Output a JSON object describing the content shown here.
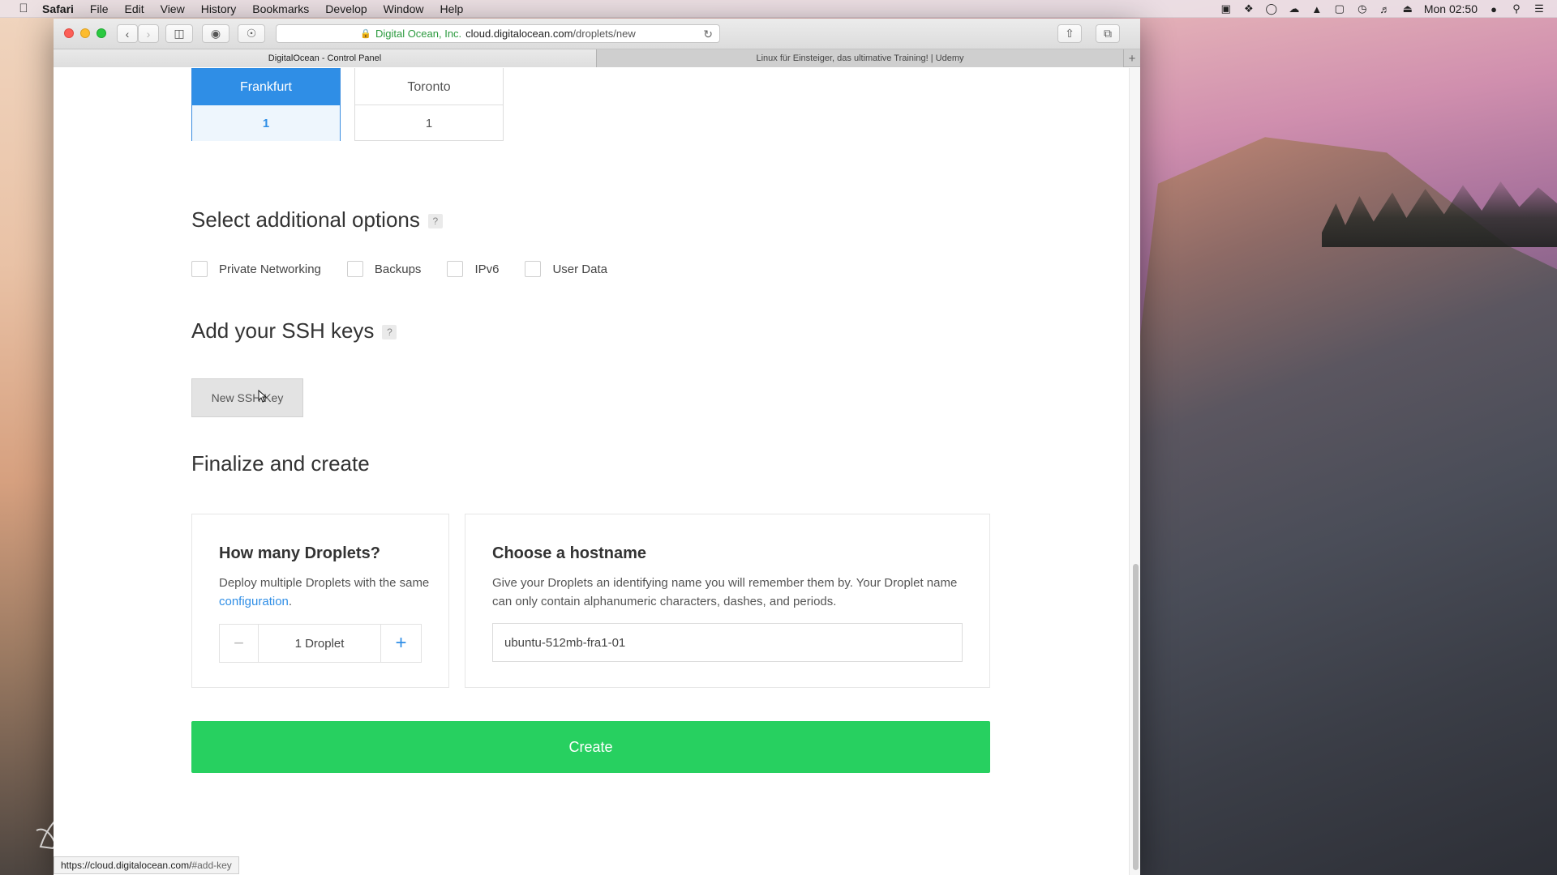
{
  "menubar": {
    "app": "Safari",
    "items": [
      "File",
      "Edit",
      "View",
      "History",
      "Bookmarks",
      "Develop",
      "Window",
      "Help"
    ],
    "clock": "Mon 02:50"
  },
  "browser": {
    "address": {
      "org": "Digital Ocean, Inc.",
      "domain": "cloud.digitalocean.com",
      "path": "/droplets/new"
    },
    "tabs": [
      {
        "label": "DigitalOcean - Control Panel",
        "active": true
      },
      {
        "label": "Linux für Einsteiger, das ultimative Training! | Udemy",
        "active": false
      }
    ],
    "status_url": {
      "host": "https://cloud.digitalocean.com/",
      "fragment": "#add-key"
    }
  },
  "regions": [
    {
      "name": "Frankfurt",
      "count": "1",
      "selected": true,
      "flag_icon": "germany-flag-icon"
    },
    {
      "name": "Toronto",
      "count": "1",
      "selected": false,
      "flag_icon": "canada-flag-icon"
    }
  ],
  "additional_options": {
    "title": "Select additional options",
    "help": "?",
    "options": [
      "Private Networking",
      "Backups",
      "IPv6",
      "User Data"
    ]
  },
  "ssh": {
    "title": "Add your SSH keys",
    "help": "?",
    "button": "New SSH Key"
  },
  "finalize": {
    "title": "Finalize and create",
    "droplets": {
      "title": "How many Droplets?",
      "desc_prefix": "Deploy multiple Droplets with the same ",
      "desc_link": "configuration",
      "desc_suffix": ".",
      "value": "1 Droplet",
      "minus": "−",
      "plus": "+"
    },
    "hostname": {
      "title": "Choose a hostname",
      "desc": "Give your Droplets an identifying name you will remember them by. Your Droplet name can only contain alphanumeric characters, dashes, and periods.",
      "value": "ubuntu-512mb-fra1-01"
    },
    "create": "Create"
  },
  "colors": {
    "accent": "#2f8ee6",
    "create": "#27d060"
  }
}
